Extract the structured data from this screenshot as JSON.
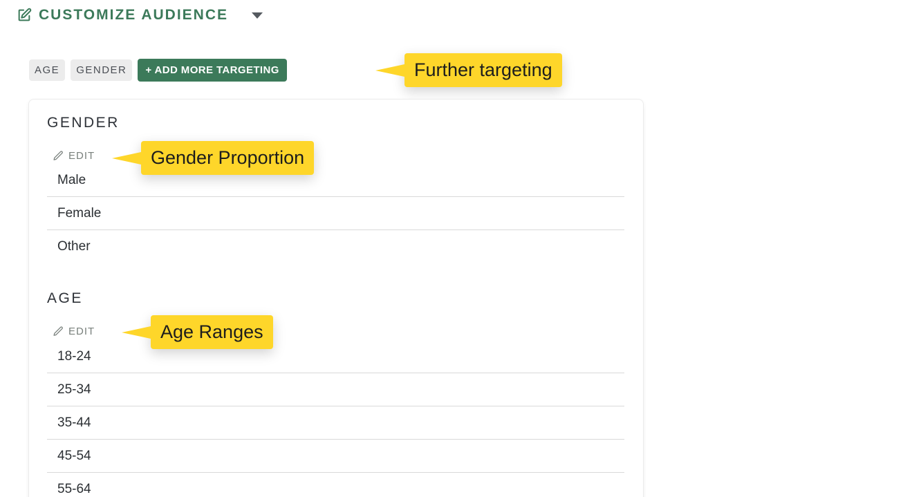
{
  "header": {
    "title": "CUSTOMIZE AUDIENCE",
    "icon": "edit-square-icon",
    "dropdown_icon": "caret-down-icon",
    "accent_color": "#3c7a5a"
  },
  "chips": {
    "age": "AGE",
    "gender": "GENDER",
    "add_more": "+ ADD MORE TARGETING"
  },
  "callouts": {
    "further_targeting": "Further targeting",
    "gender_proportion": "Gender Proportion",
    "age_ranges": "Age Ranges",
    "color": "#fed62a"
  },
  "gender_section": {
    "title": "GENDER",
    "edit_label": "EDIT",
    "rows": [
      "Male",
      "Female",
      "Other"
    ]
  },
  "age_section": {
    "title": "AGE",
    "edit_label": "EDIT",
    "rows": [
      "18-24",
      "25-34",
      "35-44",
      "45-54",
      "55-64"
    ]
  }
}
